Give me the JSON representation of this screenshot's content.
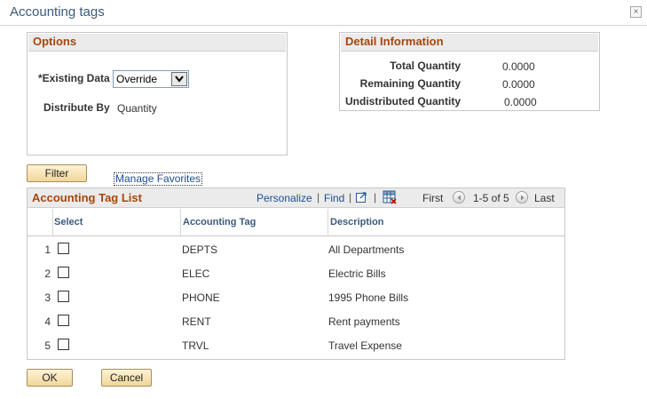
{
  "window": {
    "title": "Accounting tags",
    "close_glyph": "×"
  },
  "options": {
    "header": "Options",
    "existing_data_label": "*Existing Data",
    "existing_data_value": "Override",
    "distribute_by_label": "Distribute By",
    "distribute_by_value": "Quantity"
  },
  "detail": {
    "header": "Detail Information",
    "rows": [
      {
        "label": "Total Quantity",
        "value": "0.0000"
      },
      {
        "label": "Remaining Quantity",
        "value": "0.0000"
      },
      {
        "label": "Undistributed Quantity",
        "value": "0.0000"
      }
    ]
  },
  "toolbar": {
    "filter_label": "Filter",
    "manage_favorites_label": "Manage Favorites"
  },
  "grid": {
    "title": "Accounting Tag List",
    "personalize": "Personalize",
    "find": "Find",
    "sep": "|",
    "first": "First",
    "range": "1-5 of 5",
    "last": "Last",
    "columns": [
      "Select",
      "Accounting Tag",
      "Description"
    ],
    "rows": [
      {
        "num": "1",
        "tag": "DEPTS",
        "desc": "All Departments"
      },
      {
        "num": "2",
        "tag": "ELEC",
        "desc": "Electric Bills"
      },
      {
        "num": "3",
        "tag": "PHONE",
        "desc": "1995 Phone Bills"
      },
      {
        "num": "4",
        "tag": "RENT",
        "desc": "Rent payments"
      },
      {
        "num": "5",
        "tag": "TRVL",
        "desc": "Travel Expense"
      }
    ]
  },
  "footer": {
    "ok_label": "OK",
    "cancel_label": "Cancel"
  },
  "colors": {
    "section_header": "#a6460c",
    "link": "#1d4f91",
    "title": "#3c5a7c",
    "button": "#f2d69a"
  },
  "icons": [
    "close-icon",
    "dropdown-arrow-icon",
    "view-all-icon",
    "download-grid-icon",
    "previous-arrow-icon",
    "next-arrow-icon"
  ]
}
